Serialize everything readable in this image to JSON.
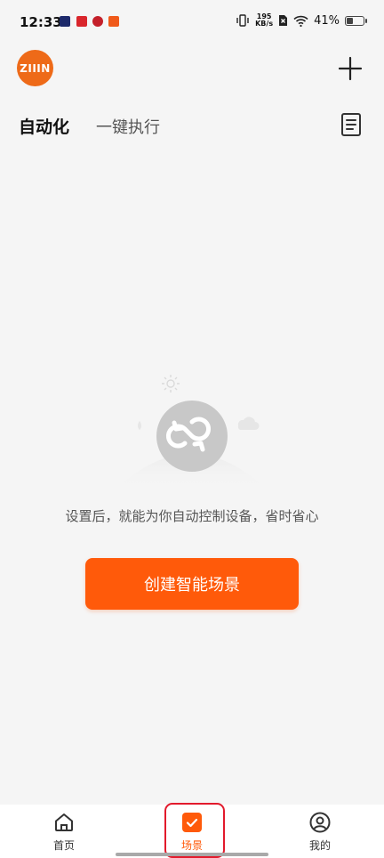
{
  "status_bar": {
    "time": "12:33",
    "net_speed_value": "195",
    "net_speed_unit": "KB/s",
    "battery": "41%",
    "battery_level": 0.41
  },
  "header": {
    "logo_text": "ZIIIN",
    "tabs": [
      {
        "label": "自动化",
        "active": true
      },
      {
        "label": "一键执行",
        "active": false
      }
    ]
  },
  "empty_state": {
    "message": "设置后，就能为你自动控制设备，省时省心",
    "create_button": "创建智能场景"
  },
  "bottom_nav": {
    "items": [
      {
        "label": "首页",
        "icon": "home-icon"
      },
      {
        "label": "场景",
        "icon": "scene-check-icon",
        "active": true
      },
      {
        "label": "我的",
        "icon": "profile-icon"
      }
    ]
  },
  "colors": {
    "accent": "#ff5a0a",
    "logo": "#ee6a18",
    "highlight": "#e21a2c"
  }
}
